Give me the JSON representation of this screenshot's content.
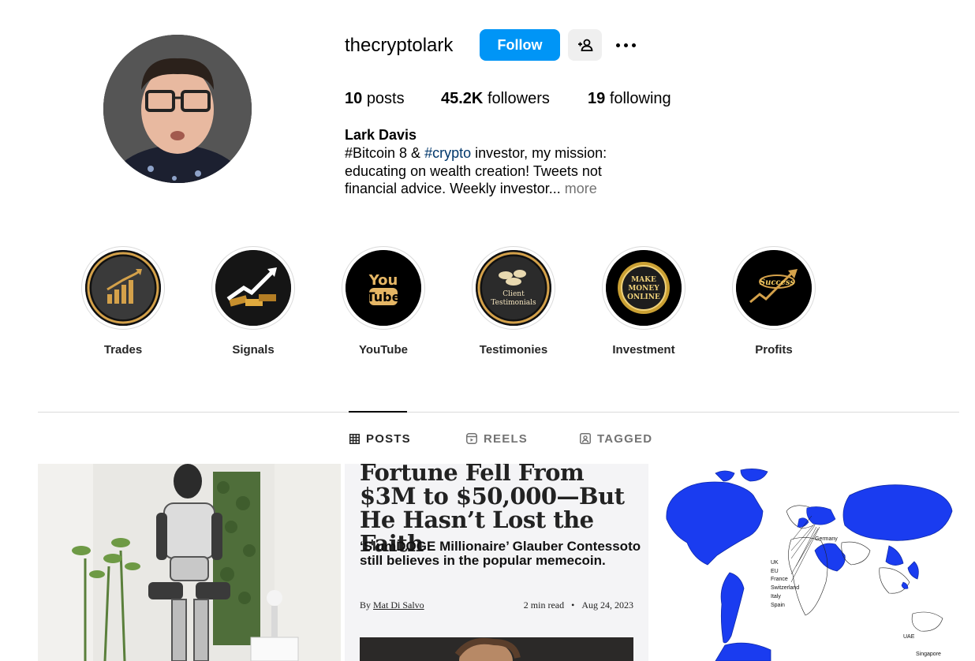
{
  "profile": {
    "username": "thecryptolark",
    "follow_label": "Follow",
    "full_name": "Lark Davis",
    "stats": {
      "posts_count": "10",
      "posts_label": "posts",
      "followers_count": "45.2K",
      "followers_label": "followers",
      "following_count": "19",
      "following_label": "following"
    },
    "bio": {
      "tag1": "#Bitcoin",
      "text1": " 8 & ",
      "tag2": "#crypto",
      "text2": " investor, my mission: educating on wealth creation! Tweets not financial advice. Weekly investor...",
      "more": " more"
    }
  },
  "highlights": [
    {
      "label": "Trades",
      "icon": "bar-chart-icon",
      "badge": ""
    },
    {
      "label": "Signals",
      "icon": "rising-arrow-gold-icon",
      "badge": ""
    },
    {
      "label": "YouTube",
      "icon": "youtube-logo-icon",
      "badge_top": "You",
      "badge_bottom": "Tube"
    },
    {
      "label": "Testimonies",
      "icon": "speech-bubbles-icon",
      "badge_top": "Client",
      "badge_bottom": "Testimonials"
    },
    {
      "label": "Investment",
      "icon": "coin-icon",
      "badge_top": "MAKE",
      "badge_mid": "MONEY",
      "badge_bottom": "ONLINE"
    },
    {
      "label": "Profits",
      "icon": "success-arrow-icon",
      "badge": "Success"
    }
  ],
  "tabs": [
    {
      "label": "POSTS",
      "icon": "grid-icon",
      "active": true
    },
    {
      "label": "REELS",
      "icon": "reels-icon",
      "active": false
    },
    {
      "label": "TAGGED",
      "icon": "tagged-icon",
      "active": false
    }
  ],
  "posts": {
    "article": {
      "title": "Fortune Fell From $3M to $50,000—But He Hasn’t Lost the Faith",
      "subtitle": "‘SlumDOGE Millionaire’ Glauber Contessoto still believes in the popular memecoin.",
      "by_prefix": "By ",
      "author": "Mat Di Salvo",
      "read_time": "2 min read",
      "separator": "•",
      "date": "Aug 24, 2023"
    },
    "map": {
      "labels": [
        "Germany",
        "UK",
        "EU",
        "France",
        "Switzerland",
        "Italy",
        "Spain",
        "UAE",
        "Singapore"
      ]
    }
  },
  "colors": {
    "follow_button": "#0095f6",
    "map_highlight": "#1a3cf0",
    "hashtag": "#00376b",
    "muted": "#737373",
    "highlight_gold": "#d4a14a"
  }
}
